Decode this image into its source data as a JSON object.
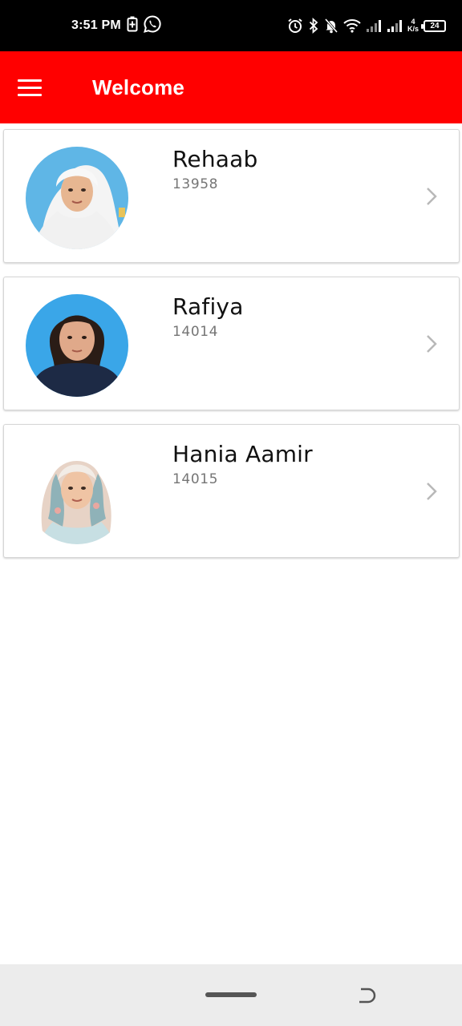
{
  "status_bar": {
    "time": "3:51 PM",
    "net_speed_value": "4",
    "net_speed_unit": "K/s",
    "battery_level": "24",
    "icons": [
      "battery-charging-icon",
      "whatsapp-icon",
      "alarm-icon",
      "bluetooth-icon",
      "mute-icon",
      "wifi-icon",
      "signal-icon",
      "signal-icon"
    ]
  },
  "app_bar": {
    "title": "Welcome",
    "background": "#ff0000",
    "menu_icon": "hamburger-menu-icon"
  },
  "students": [
    {
      "name": "Rehaab",
      "id": "13958",
      "avatar_bg": "#5fb6e6"
    },
    {
      "name": "Rafiya",
      "id": "14014",
      "avatar_bg": "#3aa6e8"
    },
    {
      "name": "Hania Aamir",
      "id": "14015",
      "avatar_bg": "#ffffff"
    }
  ],
  "nav_bar": {
    "home_icon": "home-pill-icon",
    "back_icon": "back-icon"
  }
}
